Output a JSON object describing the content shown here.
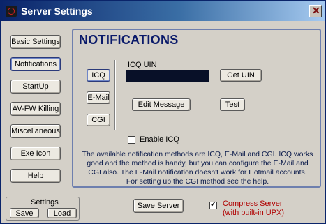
{
  "window": {
    "title": "Server Settings",
    "close_glyph": "✕"
  },
  "sidebar": {
    "items": [
      {
        "label": "Basic Settings"
      },
      {
        "label": "Notifications"
      },
      {
        "label": "StartUp"
      },
      {
        "label": "AV-FW Killing"
      },
      {
        "label": "Miscellaneous"
      },
      {
        "label": "Exe Icon"
      },
      {
        "label": "Help"
      }
    ]
  },
  "panel": {
    "title": "NOTIFICATIONS",
    "methods": [
      {
        "label": "ICQ"
      },
      {
        "label": "E-Mail"
      },
      {
        "label": "CGI"
      }
    ],
    "icq_uin_label": "ICQ UIN",
    "icq_uin_value": "",
    "get_uin_label": "Get UIN",
    "edit_message_label": "Edit Message",
    "test_label": "Test",
    "enable_icq_label": "Enable ICQ",
    "enable_icq_checked": false,
    "description": "The available notification methods are ICQ, E-Mail and CGI. ICQ works good and the method is handy, but you can configure the E-Mail and CGI also. The E-Mail notification doesn't work for Hotmail accounts. For setting up the CGI method see the help."
  },
  "settings_group": {
    "title": "Settings",
    "save_label": "Save",
    "load_label": "Load"
  },
  "footer": {
    "save_server_label": "Save Server",
    "compress_checked": true,
    "compress_line1": "Compress Server",
    "compress_line2": "(with built-in UPX)"
  },
  "colors": {
    "titlebar_start": "#0a246a",
    "panel_title": "#0a1a6a",
    "compress_text": "#b00000"
  }
}
